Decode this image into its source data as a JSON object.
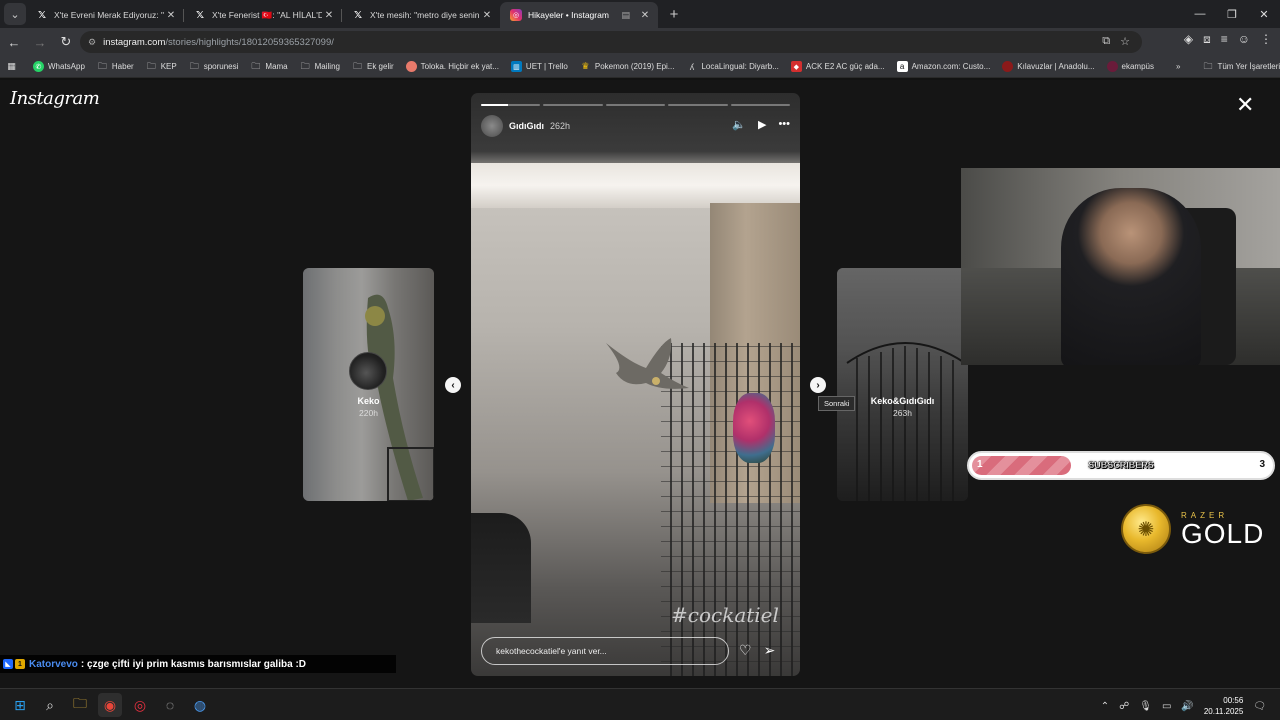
{
  "browser": {
    "tabs": [
      {
        "icon": "x-logo-icon",
        "title": "X'te Evreni Merak Ediyoruz: \"Ro",
        "active": false
      },
      {
        "icon": "x-logo-icon",
        "title": "X'te Fenerist 🇹🇷: \"AL HİLAL'DEN",
        "active": false
      },
      {
        "icon": "x-logo-icon",
        "title": "X'te mesih: \"metro diye senin k",
        "active": false
      },
      {
        "icon": "instagram-icon",
        "title": "Hikayeler • Instagram",
        "active": true
      }
    ],
    "url_host": "instagram.com",
    "url_path": "/stories/highlights/18012059365327099/",
    "bookmarks": [
      {
        "icon": "whatsapp-icon",
        "label": "WhatsApp"
      },
      {
        "icon": "folder-icon",
        "label": "Haber"
      },
      {
        "icon": "folder-icon",
        "label": "KEP"
      },
      {
        "icon": "folder-icon",
        "label": "sporunesi"
      },
      {
        "icon": "folder-icon",
        "label": "Mama"
      },
      {
        "icon": "folder-icon",
        "label": "Mailing"
      },
      {
        "icon": "folder-icon",
        "label": "Ek gelir"
      },
      {
        "icon": "toloka-icon",
        "label": "Toloka. Hiçbir ek yat..."
      },
      {
        "icon": "trello-icon",
        "label": "UET | Trello"
      },
      {
        "icon": "crown-icon",
        "label": "Pokemon (2019) Epi..."
      },
      {
        "icon": "localingual-icon",
        "label": "LocaLingual: Diyarb..."
      },
      {
        "icon": "ack-icon",
        "label": "ACK E2 AC güç ada..."
      },
      {
        "icon": "amazon-icon",
        "label": "Amazon.com: Custo..."
      },
      {
        "icon": "anadolu-icon",
        "label": "Kılavuzlar | Anadolu..."
      },
      {
        "icon": "ekampus-icon",
        "label": "ekampüs"
      }
    ],
    "bookmarks_overflow": "»",
    "all_bookmarks": "Tüm Yer İşaretleri"
  },
  "instagram": {
    "logo": "Instagram",
    "prev_story": {
      "name": "Keko",
      "time": "220h"
    },
    "next_story": {
      "name": "Keko&GıdıGıdı",
      "time": "263h"
    },
    "current_story": {
      "user": "GıdıGıdı",
      "time": "262h",
      "progress_segments": [
        0.45,
        0,
        0,
        0,
        0
      ],
      "hashtag": "#cockatiel",
      "reply_placeholder": "kekothecockatiel'e yanıt ver..."
    },
    "next_tooltip": "Sonraki"
  },
  "overlay": {
    "subs_start": "1",
    "subs_label": "SUBSCRIBERS",
    "subs_end": "3",
    "subs_progress": 0.33,
    "razer_top": "RAZER",
    "razer_bottom": "GOLD",
    "chat_user": "Katorvevo",
    "chat_message": ": çzge çifti iyi prim kasmıs barısmıslar galiba :D"
  },
  "taskbar": {
    "time": "00:56",
    "date": "20.11.2025"
  }
}
